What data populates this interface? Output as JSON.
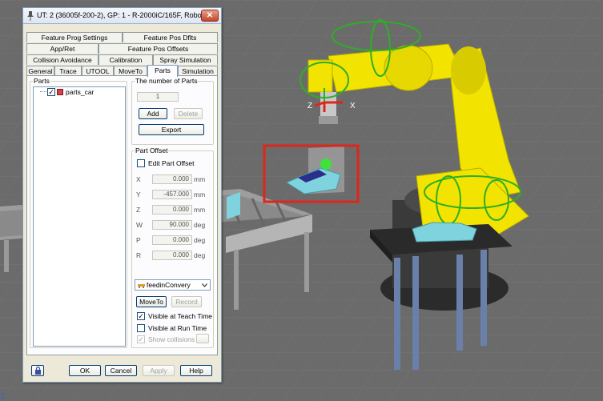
{
  "window": {
    "title": "UT: 2  (36005f-200-2), GP: 1 - R-2000iC/165F, Robo...",
    "close_glyph": "✕"
  },
  "tabs": {
    "row1": [
      "Feature Prog Settings",
      "Feature Pos Dflts"
    ],
    "row2": [
      "App/Ret",
      "Feature Pos Offsets"
    ],
    "row3": [
      "Collision Avoidance",
      "Calibration",
      "Spray Simulation"
    ],
    "row4": [
      "General",
      "Trace",
      "UTOOL",
      "MoveTo",
      "Parts",
      "Simulation"
    ],
    "active": "Parts"
  },
  "parts": {
    "group_label": "Parts",
    "tree_item": "parts_car",
    "tree_item_checked": "✓"
  },
  "number_of_parts": {
    "group_label": "The number of Parts",
    "value": "1",
    "add_label": "Add",
    "delete_label": "Delete",
    "export_label": "Export"
  },
  "part_offset": {
    "group_label": "Part Offset",
    "edit_label": "Edit Part Offset",
    "rows": [
      {
        "axis": "X",
        "value": "0.000",
        "unit": "mm"
      },
      {
        "axis": "Y",
        "value": "-457.000",
        "unit": "mm"
      },
      {
        "axis": "Z",
        "value": "0.000",
        "unit": "mm"
      },
      {
        "axis": "W",
        "value": "90.000",
        "unit": "deg"
      },
      {
        "axis": "P",
        "value": "0.000",
        "unit": "deg"
      },
      {
        "axis": "R",
        "value": "0.000",
        "unit": "deg"
      }
    ]
  },
  "moveto": {
    "dropdown_value": "feedinConvery",
    "moveto_label": "MoveTo",
    "record_label": "Record"
  },
  "visibility": {
    "teach_label": "Visible at Teach Time",
    "teach_checked": "✓",
    "run_label": "Visible at Run Time",
    "run_checked": "",
    "collisions_label": "Show collisions",
    "collisions_checked": "✓"
  },
  "footer": {
    "ok_label": "OK",
    "cancel_label": "Cancel",
    "apply_label": "Apply",
    "help_label": "Help"
  },
  "scene": {
    "axis_z": "Z",
    "axis_x": "X",
    "corner_label": "Z",
    "robot_color": "#f2e400",
    "highlight_color": "#e0251b"
  }
}
